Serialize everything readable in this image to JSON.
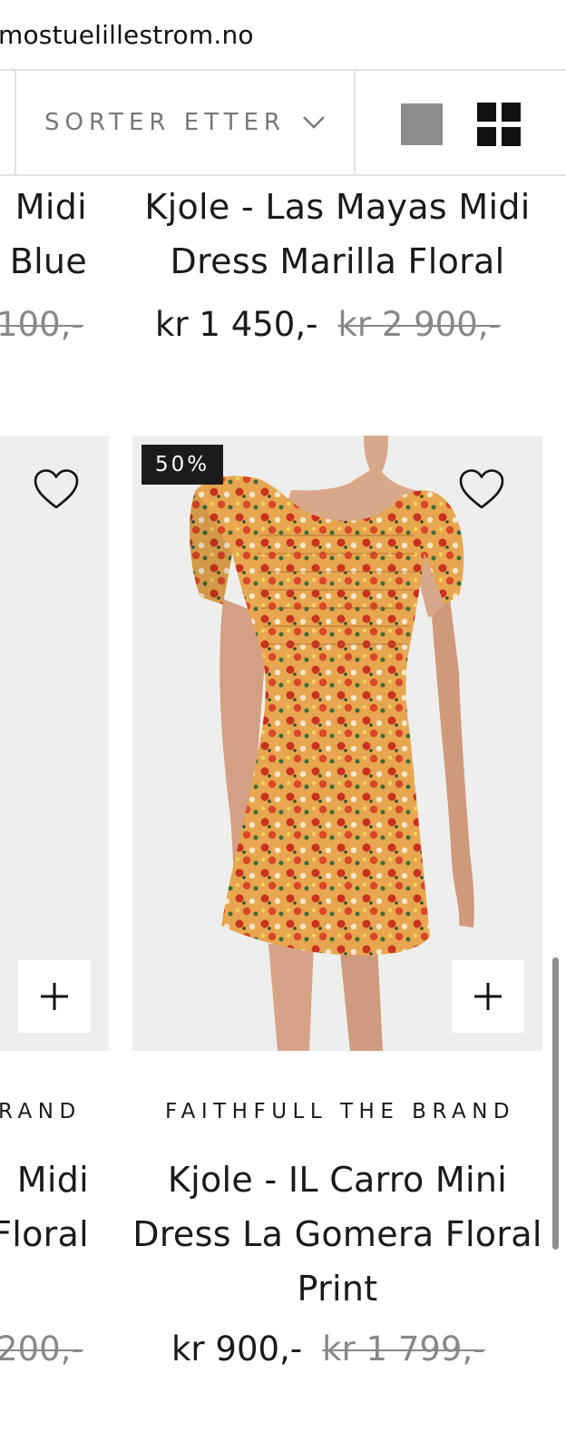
{
  "browser": {
    "url": "mostuelillestrom.no"
  },
  "toolbar": {
    "sort_label": "SORTER ETTER",
    "view_icons": [
      "single-column-view-icon",
      "grid-view-icon"
    ]
  },
  "products_top": {
    "left_partial": {
      "title_line1": "Midi",
      "title_line2": "Blue",
      "price_old": "100,-"
    },
    "right": {
      "title_line1": "Kjole - Las Mayas Midi",
      "title_line2": "Dress Marilla Floral",
      "price_now": "kr 1 450,-",
      "price_old": "kr 2 900,-"
    }
  },
  "products_bottom": {
    "left_partial": {
      "brand": "RAND",
      "title_line1": "Midi",
      "title_line2": "Floral",
      "price_old": "200,-"
    },
    "right": {
      "badge": "50%",
      "brand": "FAITHFULL THE BRAND",
      "title_line1": "Kjole - IL Carro Mini",
      "title_line2": "Dress La Gomera Floral",
      "title_line3": "Print",
      "price_now": "kr 900,-",
      "price_old": "kr 1 799,-"
    }
  },
  "colors": {
    "image_bg": "#eeeeec",
    "badge_bg": "#1b1b1b",
    "muted_text": "#777777"
  }
}
